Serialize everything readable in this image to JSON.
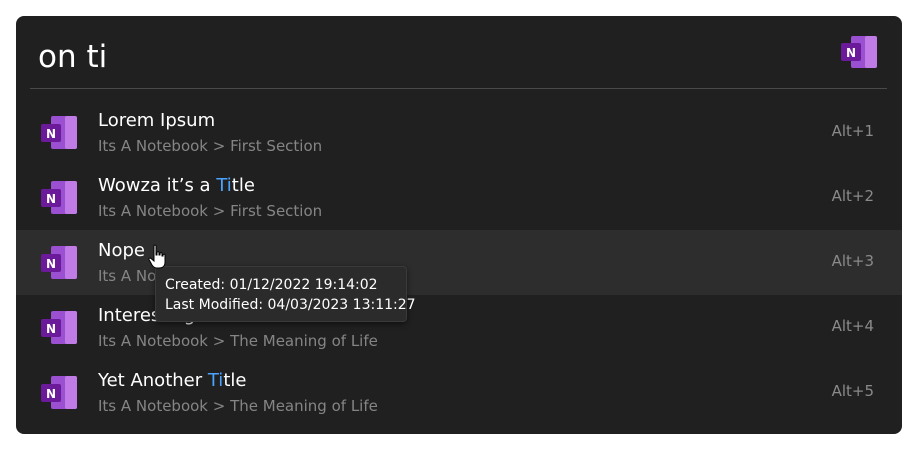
{
  "search": {
    "query": "on ti"
  },
  "app": {
    "icon": "onenote-icon",
    "brand_color": "#7719aa"
  },
  "results": [
    {
      "title_parts": [
        "Lorem Ipsum"
      ],
      "title_highlight": "",
      "title_after": "",
      "path": "Its A Notebook > First Section",
      "shortcut": "Alt+1"
    },
    {
      "title_parts": [
        "Wowza it’s a "
      ],
      "title_highlight": "Ti",
      "title_after": "tle",
      "path": "Its A Notebook > First Section",
      "shortcut": "Alt+2"
    },
    {
      "title_parts": [
        "Nope"
      ],
      "title_highlight": "",
      "title_after": "",
      "path": "Its A Notebook > First Section",
      "shortcut": "Alt+3"
    },
    {
      "title_parts": [
        "Interesting Title"
      ],
      "title_highlight": "",
      "title_after": "",
      "path": "Its A Notebook > The Meaning of Life",
      "shortcut": "Alt+4"
    },
    {
      "title_parts": [
        "Yet Another "
      ],
      "title_highlight": "Ti",
      "title_after": "tle",
      "path": "Its A Notebook > The Meaning of Life",
      "shortcut": "Alt+5"
    }
  ],
  "tooltip": {
    "created": "Created: 01/12/2022 19:14:02",
    "modified": "Last Modified: 04/03/2023 13:11:27"
  },
  "colors": {
    "highlight": "#4aa3ff",
    "background": "#202020",
    "hover_row": "#2d2d2d"
  }
}
